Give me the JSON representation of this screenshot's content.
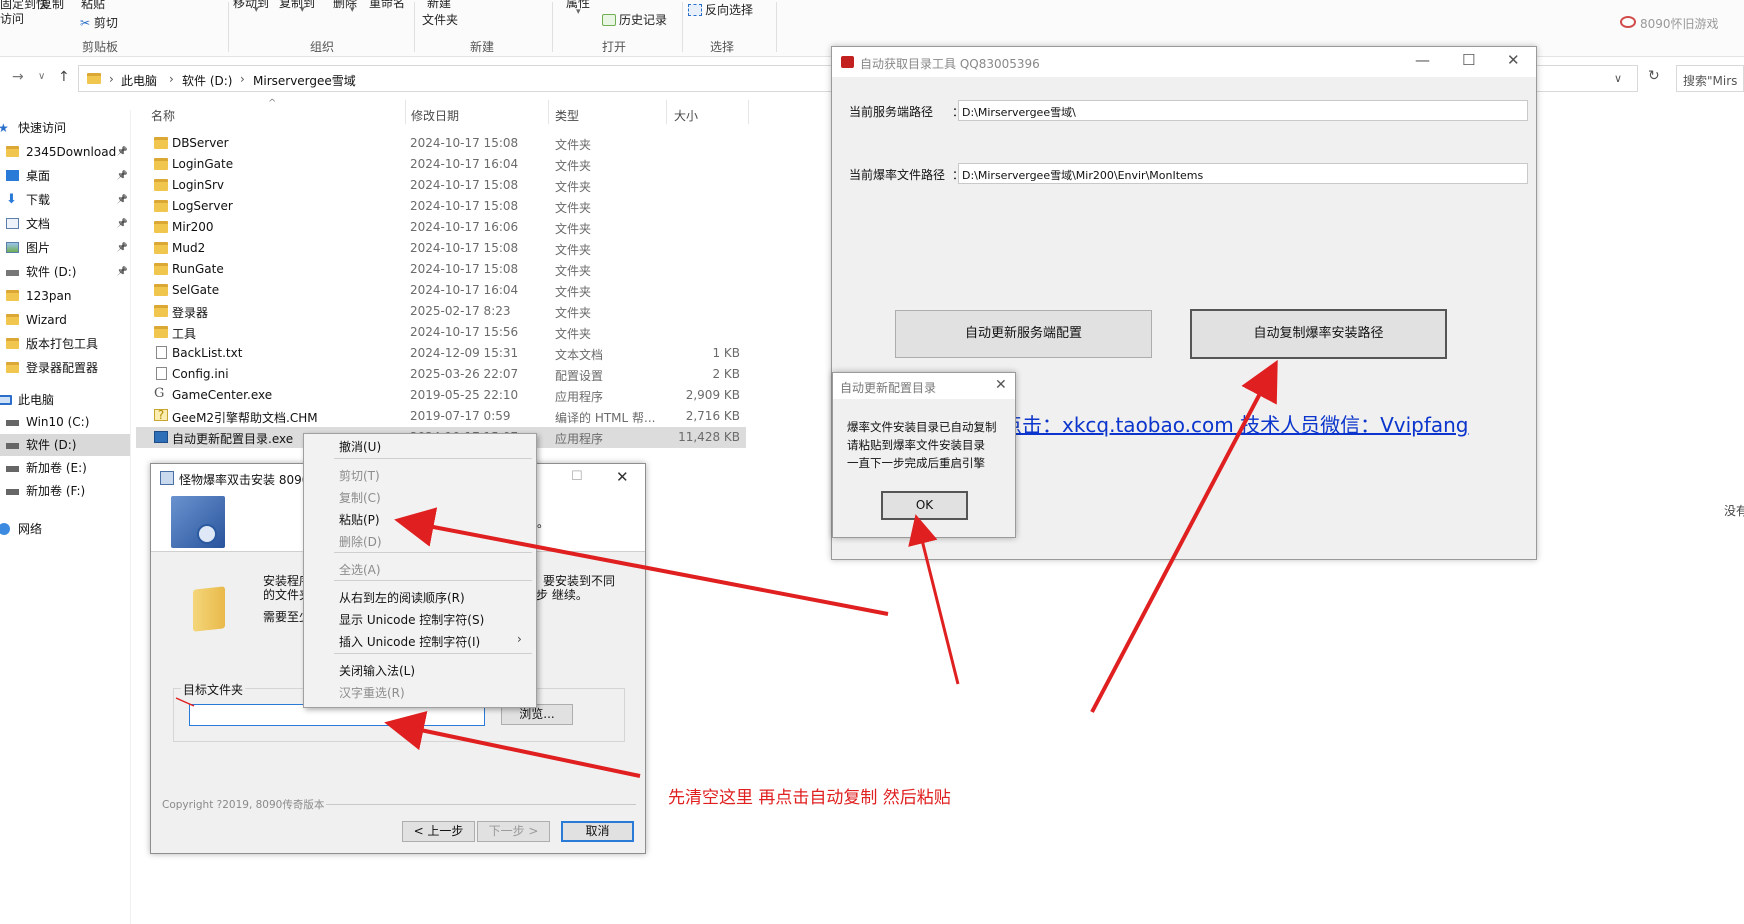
{
  "ribbon": {
    "clipboard": {
      "quick_access_top": "固定到快",
      "quick_access_bottom": "访问",
      "copy": "复制",
      "paste": "粘贴",
      "cut": "剪切",
      "group": "剪贴板"
    },
    "organize": {
      "move_to": "移动到",
      "copy_to": "复制到",
      "group": "组织"
    },
    "delete": "删除",
    "rename": "重命名",
    "new": {
      "new_top": "新建",
      "new_folder": "文件夹",
      "group": "新建"
    },
    "open": {
      "properties": "属性",
      "history": "历史记录",
      "group": "打开"
    },
    "select": {
      "invert": "反向选择",
      "group": "选择"
    },
    "watermark": "8090怀旧游戏"
  },
  "address": {
    "crumbs": [
      "此电脑",
      "软件 (D:)",
      "Mirservergee雪域"
    ],
    "search_placeholder": "搜索\"Mirs"
  },
  "nav": {
    "quick_access": "快速访问",
    "items": [
      {
        "label": "2345Download",
        "pinned": true,
        "icon": "folder-icon"
      },
      {
        "label": "桌面",
        "pinned": true,
        "icon": "desktop-icon"
      },
      {
        "label": "下载",
        "pinned": true,
        "icon": "download-icon"
      },
      {
        "label": "文档",
        "pinned": true,
        "icon": "documents-icon"
      },
      {
        "label": "图片",
        "pinned": true,
        "icon": "pictures-icon"
      },
      {
        "label": "软件 (D:)",
        "pinned": true,
        "icon": "drive-icon"
      },
      {
        "label": "123pan",
        "pinned": false,
        "icon": "folder-icon"
      },
      {
        "label": "Wizard",
        "pinned": false,
        "icon": "folder-icon"
      },
      {
        "label": "版本打包工具",
        "pinned": false,
        "icon": "folder-icon"
      },
      {
        "label": "登录器配置器",
        "pinned": false,
        "icon": "folder-icon"
      }
    ],
    "this_pc": "此电脑",
    "drives": [
      {
        "label": "Win10 (C:)",
        "selected": false
      },
      {
        "label": "软件 (D:)",
        "selected": true
      },
      {
        "label": "新加卷 (E:)",
        "selected": false
      },
      {
        "label": "新加卷 (F:)",
        "selected": false
      }
    ],
    "network": "网络"
  },
  "filelist": {
    "headers": {
      "name": "名称",
      "date": "修改日期",
      "type": "类型",
      "size": "大小"
    },
    "rows": [
      {
        "name": "DBServer",
        "date": "2024-10-17 15:08",
        "type": "文件夹",
        "size": "",
        "icon": "folder-icon"
      },
      {
        "name": "LoginGate",
        "date": "2024-10-17 16:04",
        "type": "文件夹",
        "size": "",
        "icon": "folder-icon"
      },
      {
        "name": "LoginSrv",
        "date": "2024-10-17 15:08",
        "type": "文件夹",
        "size": "",
        "icon": "folder-icon"
      },
      {
        "name": "LogServer",
        "date": "2024-10-17 15:08",
        "type": "文件夹",
        "size": "",
        "icon": "folder-icon"
      },
      {
        "name": "Mir200",
        "date": "2024-10-17 16:06",
        "type": "文件夹",
        "size": "",
        "icon": "folder-icon"
      },
      {
        "name": "Mud2",
        "date": "2024-10-17 15:08",
        "type": "文件夹",
        "size": "",
        "icon": "folder-icon"
      },
      {
        "name": "RunGate",
        "date": "2024-10-17 15:08",
        "type": "文件夹",
        "size": "",
        "icon": "folder-icon"
      },
      {
        "name": "SelGate",
        "date": "2024-10-17 16:04",
        "type": "文件夹",
        "size": "",
        "icon": "folder-icon"
      },
      {
        "name": "登录器",
        "date": "2025-02-17 8:23",
        "type": "文件夹",
        "size": "",
        "icon": "folder-icon"
      },
      {
        "name": "工具",
        "date": "2024-10-17 15:56",
        "type": "文件夹",
        "size": "",
        "icon": "folder-icon"
      },
      {
        "name": "BackList.txt",
        "date": "2024-12-09 15:31",
        "type": "文本文档",
        "size": "1 KB",
        "icon": "text-file-icon"
      },
      {
        "name": "Config.ini",
        "date": "2025-03-26 22:07",
        "type": "配置设置",
        "size": "2 KB",
        "icon": "ini-file-icon"
      },
      {
        "name": "GameCenter.exe",
        "date": "2019-05-25 22:10",
        "type": "应用程序",
        "size": "2,909 KB",
        "icon": "app-g-icon"
      },
      {
        "name": "GeeM2引擎帮助文档.CHM",
        "date": "2019-07-17 0:59",
        "type": "编译的 HTML 帮...",
        "size": "2,716 KB",
        "icon": "chm-file-icon"
      },
      {
        "name": "自动更新配置目录.exe",
        "date": "2024-10-17 15:07",
        "type": "应用程序",
        "size": "11,428 KB",
        "icon": "exe-file-icon",
        "selected": true
      }
    ]
  },
  "tool_window": {
    "title": "自动获取目录工具 QQ83005396",
    "server_path_label": "当前服务端路径",
    "server_path_value": "D:\\Mirservergee雪域\\",
    "drop_path_label": "当前爆率文件路径",
    "drop_path_value": "D:\\Mirservergee雪域\\Mir200\\Envir\\MonItems",
    "btn_update": "自动更新服务端配置",
    "btn_copy": "自动复制爆率安装路径",
    "link_text": "点击：xkcq.taobao.com   技术人员微信：Vvipfang"
  },
  "msgbox": {
    "title": "自动更新配置目录",
    "lines": [
      "爆率文件安装目录已自动复制",
      "请粘贴到爆率文件安装目录",
      "一直下一步完成后重启引擎"
    ],
    "ok": "OK"
  },
  "installer": {
    "title": "怪物爆率双击安装 8090",
    "body_line1": "安装程序",
    "body_line1_tail": "要安装到不同",
    "body_line2": "的文件夹",
    "body_line2_tail": "步 继续。",
    "body_line3": "需要至少",
    "head_tail": "。",
    "target_label": "目标文件夹",
    "browse": "浏览...",
    "copyright": "Copyright ?2019, 8090传奇版本",
    "back": "< 上一步",
    "next": "下一步 >",
    "cancel": "取消"
  },
  "context_menu": {
    "items": [
      {
        "label": "撤消(U)",
        "disabled": false
      },
      {
        "label": "剪切(T)",
        "disabled": true
      },
      {
        "label": "复制(C)",
        "disabled": true
      },
      {
        "label": "粘贴(P)",
        "disabled": false
      },
      {
        "label": "删除(D)",
        "disabled": true
      },
      {
        "label": "全选(A)",
        "disabled": true
      },
      {
        "label": "从右到左的阅读顺序(R)",
        "disabled": false
      },
      {
        "label": "显示 Unicode 控制字符(S)",
        "disabled": false
      },
      {
        "label": "插入 Unicode 控制字符(I)",
        "disabled": false,
        "submenu": true
      },
      {
        "label": "关闭输入法(L)",
        "disabled": false
      },
      {
        "label": "汉字重选(R)",
        "disabled": true
      }
    ]
  },
  "annotation": {
    "text": "先清空这里 再点击自动复制  然后粘贴",
    "color": "#e02020"
  },
  "edge_text": "没有"
}
